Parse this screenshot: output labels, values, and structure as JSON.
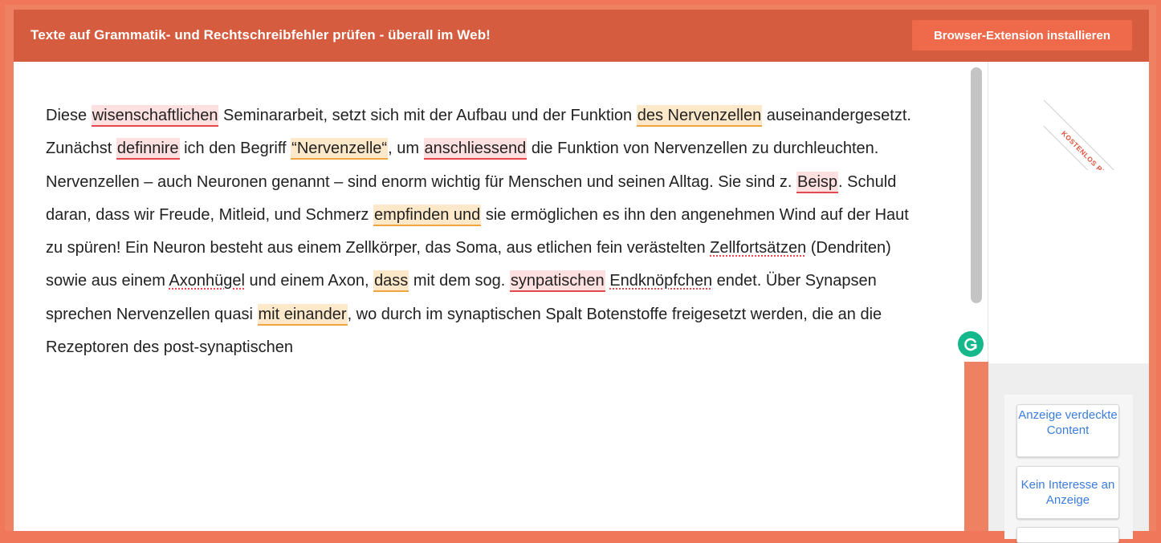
{
  "header": {
    "title": "Texte auf Grammatik- und Rechtschreibfehler prüfen - überall im Web!",
    "cta_button": "Browser-Extension installieren"
  },
  "ribbon": {
    "label": "KOSTENLOS REGISTRIEREN"
  },
  "editor": {
    "segments": {
      "s0": "Diese ",
      "e1": "wisenschaftlichen",
      "s1": " Seminararbeit, setzt sich mit der Aufbau und der Funktion ",
      "e2": "des Nervenzellen",
      "s2": " auseinandergesetzt. Zunächst ",
      "e3": "definnire",
      "s3": " ich den Begriff ",
      "e4": "“Nervenzelle“",
      "s4": ", um ",
      "e5": "anschliessend",
      "s5": " die Funktion von Nervenzellen zu durchleuchten. Nervenzellen – auch Neuronen genannt – sind enorm wichtig für Menschen und seinen Alltag. Sie sind z. ",
      "e6": "Beisp",
      "s6": ". Schuld daran, dass wir Freude, Mitleid, und Schmerz ",
      "e7": "empfinden und",
      "s7": " sie ermöglichen es ihn den angenehmen Wind auf der Haut zu spüren! Ein Neuron besteht aus einem Zellkörper, das Soma, aus etlichen fein verästelten ",
      "e8": "Zellfortsätzen",
      "s8": " (Dendriten) sowie aus einem ",
      "e9": "Axonhügel",
      "s9": " und einem Axon, ",
      "e10": "dass",
      "s10": " mit dem sog. ",
      "e11": "synpatischen",
      "s11": " ",
      "e12": "Endknöpfchen",
      "s12": " endet. Über Synapsen sprechen Nervenzellen quasi ",
      "e13": "mit einander",
      "s13": ", wo durch im synaptischen Spalt Botenstoffe freigesetzt werden, die an die Rezeptoren des post-synaptischen"
    }
  },
  "sidebar": {
    "ad_buttons": {
      "covered": "Anzeige verdeckte Content",
      "not_interested": "Kein Interesse an Anzeige"
    }
  },
  "colors": {
    "header_bg": "#d55c3f",
    "cta_bg": "#ef6a4b",
    "frame": "#f0775a",
    "spelling_error": "#e5484d",
    "grammar_error": "#f0a640",
    "grammarly_green": "#14b88a",
    "link_blue": "#3b7ddd"
  },
  "icons": {
    "grammarly": "grammarly-icon"
  }
}
